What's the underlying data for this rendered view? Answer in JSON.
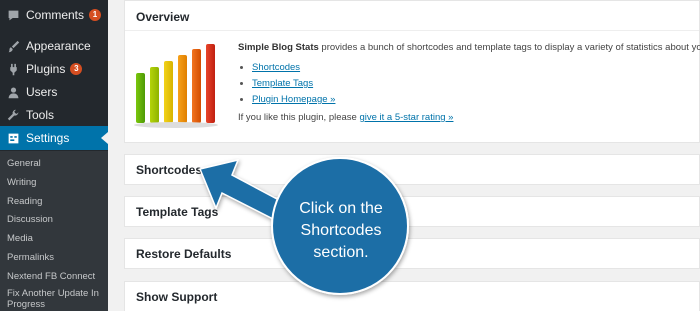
{
  "sidebar": {
    "menu": [
      {
        "label": "Comments",
        "badge": "1",
        "icon": "comment-icon"
      },
      {
        "label": "Appearance",
        "icon": "paintbrush-icon"
      },
      {
        "label": "Plugins",
        "badge": "3",
        "icon": "plug-icon"
      },
      {
        "label": "Users",
        "icon": "users-icon"
      },
      {
        "label": "Tools",
        "icon": "wrench-icon"
      },
      {
        "label": "Settings",
        "icon": "settings-icon",
        "active": true
      }
    ],
    "submenu": [
      "General",
      "Writing",
      "Reading",
      "Discussion",
      "Media",
      "Permalinks",
      "Nextend FB Connect",
      "Fix Another Update In Progress"
    ]
  },
  "overview": {
    "title": "Overview",
    "plugin_name": "Simple Blog Stats",
    "description": " provides a bunch of shortcodes and template tags to display a variety of statistics about your site.",
    "links": [
      "Shortcodes",
      "Template Tags",
      "Plugin Homepage »"
    ],
    "rate_prefix": "If you like this plugin, please ",
    "rate_link": "give it a 5-star rating »"
  },
  "sections": [
    "Shortcodes",
    "Template Tags",
    "Restore Defaults",
    "Show Support"
  ],
  "callout": {
    "text": "Click on the Shortcodes section."
  },
  "colors": {
    "sidebar": "#23282d",
    "active": "#0073aa",
    "callout": "#1e6ea6",
    "link": "#0073aa"
  }
}
